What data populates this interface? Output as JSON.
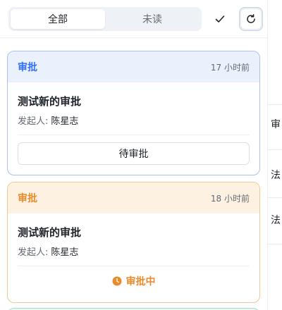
{
  "tabs": [
    {
      "label": "全部",
      "active": true
    },
    {
      "label": "未读",
      "active": false
    }
  ],
  "toolbar": {
    "mark_read_icon": "check-icon",
    "refresh_icon": "refresh-icon"
  },
  "cards": [
    {
      "type": "审批",
      "time": "17 小时前",
      "title": "测试新的审批",
      "initiator_label": "发起人:",
      "initiator": "陈星志",
      "action_label": "待审批",
      "accent": "#3370ff"
    },
    {
      "type": "审批",
      "time": "18 小时前",
      "title": "测试新的审批",
      "initiator_label": "发起人:",
      "initiator": "陈星志",
      "status_label": "审批中",
      "status_icon": "clock-icon",
      "accent": "#e98b2a"
    }
  ],
  "background_page": {
    "glyphs": [
      "审",
      "法",
      "法"
    ]
  }
}
